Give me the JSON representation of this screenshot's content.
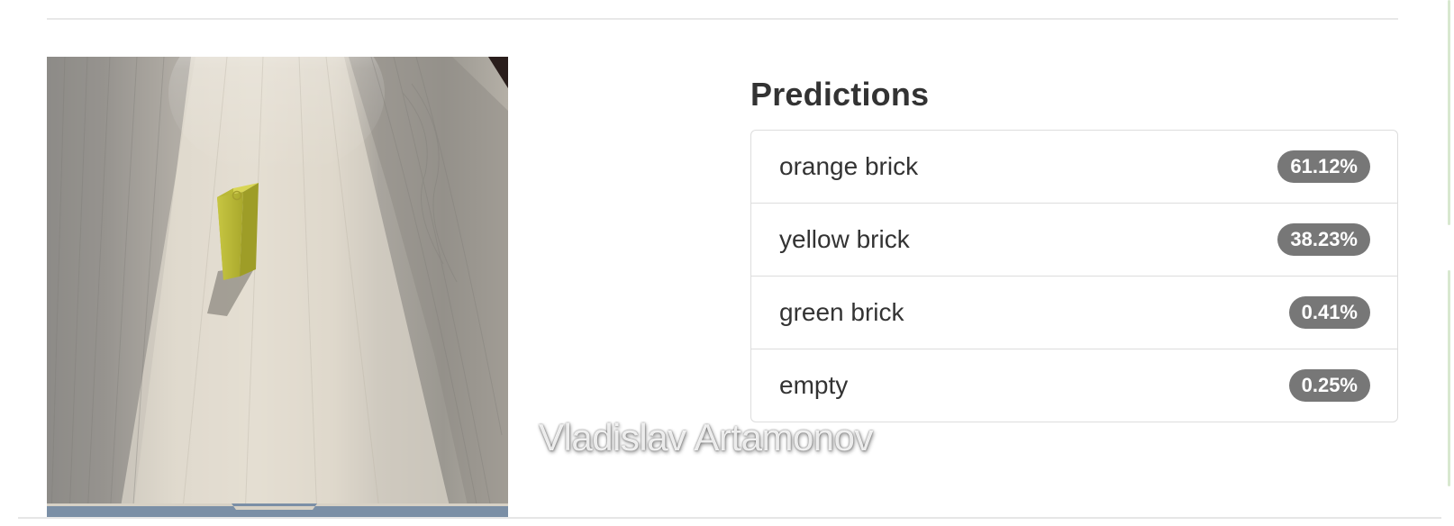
{
  "predictions": {
    "title": "Predictions",
    "items": [
      {
        "label": "orange brick",
        "value": "61.12%"
      },
      {
        "label": "yellow brick",
        "value": "38.23%"
      },
      {
        "label": "green brick",
        "value": "0.41%"
      },
      {
        "label": "empty",
        "value": "0.25%"
      }
    ]
  },
  "watermark": "Vladislav Artamonov",
  "colors": {
    "badge": "#777777",
    "text": "#333333",
    "border": "#dddddd",
    "brick": "#c9c93a"
  },
  "image": {
    "subject": "yellow-brick-on-wooden-table"
  }
}
